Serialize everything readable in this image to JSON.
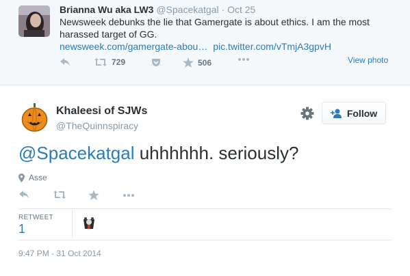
{
  "parent_tweet": {
    "name": "Brianna Wu aka LW3",
    "handle": "@Spacekatgal",
    "separator": "·",
    "date": "Oct 25",
    "text": "Newsweek debunks the lie that Gamergate is about ethics. I am the most harassed target of GG.",
    "links": [
      "newsweek.com/gamergate-abou…",
      "pic.twitter.com/vTmjA3gpvH"
    ],
    "retweets": "729",
    "favorites": "506",
    "view_photo": "View photo"
  },
  "main_tweet": {
    "name": "Khaleesi of SJWs",
    "handle": "@TheQuinnspiracy",
    "follow_label": "Follow",
    "mention": "@Spacekatgal",
    "text": " uhhhhhh. seriously?",
    "location": "Asse",
    "retweet_label": "RETWEET",
    "retweet_count": "1",
    "timestamp": "9:47 PM - 31 Oct 2014"
  },
  "icons": {
    "reply": "reply-icon",
    "retweet": "retweet-icon",
    "pocket": "pocket-icon",
    "favorite": "star-icon",
    "more": "more-icon",
    "gear": "gear-icon",
    "follow": "add-user-icon",
    "location": "location-pin-icon"
  },
  "colors": {
    "link": "#2b7bb9",
    "text": "#292f33",
    "muted": "#8899a6",
    "icon": "#aab8c2",
    "parent_bg": "#f5f8fa",
    "border": "#e1e8ed"
  }
}
